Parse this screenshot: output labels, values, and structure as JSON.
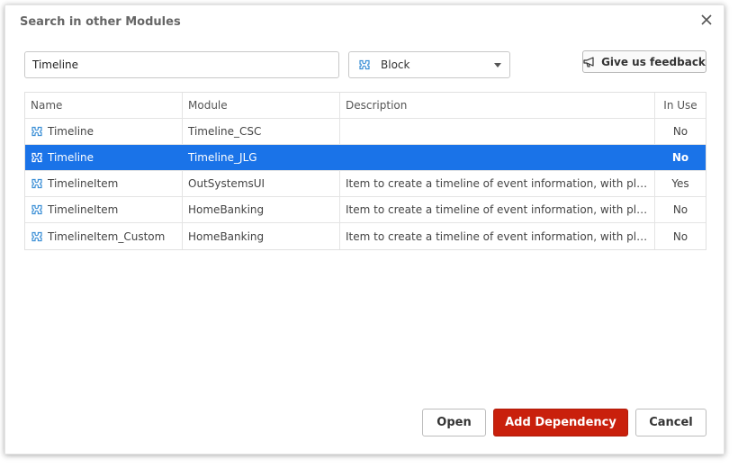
{
  "dialog": {
    "title": "Search in other Modules",
    "close_icon": "close-icon"
  },
  "search": {
    "value": "Timeline"
  },
  "type_select": {
    "selected": "Block",
    "icon": "block-icon"
  },
  "feedback": {
    "label": "Give us feedback",
    "icon": "megaphone-icon"
  },
  "table": {
    "columns": [
      "Name",
      "Module",
      "Description",
      "In Use"
    ],
    "rows": [
      {
        "name": "Timeline",
        "module": "Timeline_CSC",
        "description": "",
        "in_use": "No"
      },
      {
        "name": "Timeline",
        "module": "Timeline_JLG",
        "description": "",
        "in_use": "No"
      },
      {
        "name": "TimelineItem",
        "module": "OutSystemsUI",
        "description": "Item to create a timeline of event information, with place...",
        "in_use": "Yes"
      },
      {
        "name": "TimelineItem",
        "module": "HomeBanking",
        "description": "Item to create a timeline of event information, with place...",
        "in_use": "No"
      },
      {
        "name": "TimelineItem_Custom",
        "module": "HomeBanking",
        "description": "Item to create a timeline of event information, with place...",
        "in_use": "No"
      }
    ],
    "selected_row": 1
  },
  "buttons": {
    "open": "Open",
    "add_dependency": "Add Dependency",
    "cancel": "Cancel"
  },
  "colors": {
    "selection": "#1a73e8",
    "primary_button": "#c9200c",
    "block_icon": "#3b8fd6"
  }
}
